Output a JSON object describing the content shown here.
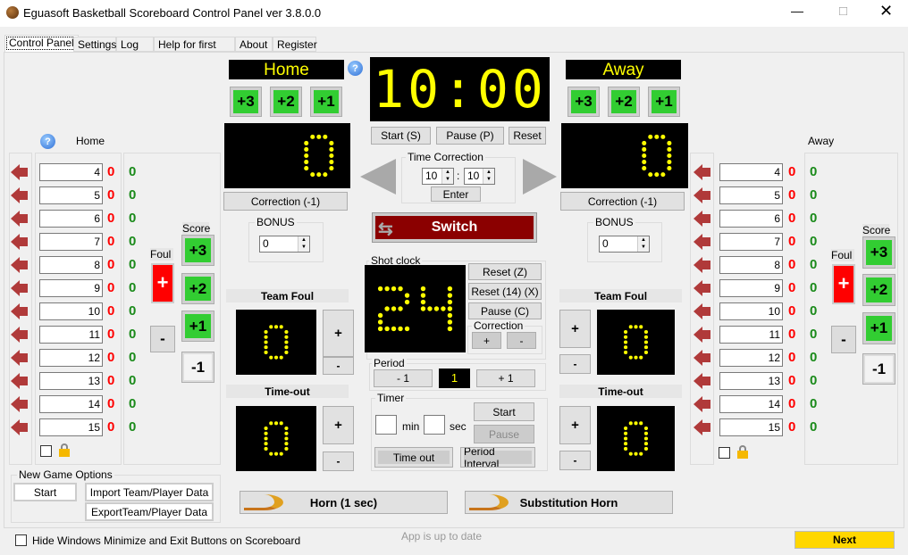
{
  "window": {
    "title": "Eguasoft Basketball Scoreboard Control Panel ver 3.8.0.0"
  },
  "tabs": [
    "Control Panel",
    "Settings",
    "Log",
    "Help for first step",
    "About",
    "Register"
  ],
  "home": {
    "name": "Home",
    "label": "Home",
    "score": "0",
    "team_foul": "0",
    "timeout": "0",
    "bonus": "0",
    "correction": "Correction (-1)",
    "players": [
      {
        "num": "4",
        "fouls": "0",
        "points": "0"
      },
      {
        "num": "5",
        "fouls": "0",
        "points": "0"
      },
      {
        "num": "6",
        "fouls": "0",
        "points": "0"
      },
      {
        "num": "7",
        "fouls": "0",
        "points": "0"
      },
      {
        "num": "8",
        "fouls": "0",
        "points": "0"
      },
      {
        "num": "9",
        "fouls": "0",
        "points": "0"
      },
      {
        "num": "10",
        "fouls": "0",
        "points": "0"
      },
      {
        "num": "11",
        "fouls": "0",
        "points": "0"
      },
      {
        "num": "12",
        "fouls": "0",
        "points": "0"
      },
      {
        "num": "13",
        "fouls": "0",
        "points": "0"
      },
      {
        "num": "14",
        "fouls": "0",
        "points": "0"
      },
      {
        "num": "15",
        "fouls": "0",
        "points": "0"
      }
    ]
  },
  "away": {
    "name": "Away",
    "label": "Away",
    "score": "0",
    "team_foul": "0",
    "timeout": "0",
    "bonus": "0",
    "correction": "Correction (-1)",
    "players": [
      {
        "num": "4",
        "fouls": "0",
        "points": "0"
      },
      {
        "num": "5",
        "fouls": "0",
        "points": "0"
      },
      {
        "num": "6",
        "fouls": "0",
        "points": "0"
      },
      {
        "num": "7",
        "fouls": "0",
        "points": "0"
      },
      {
        "num": "8",
        "fouls": "0",
        "points": "0"
      },
      {
        "num": "9",
        "fouls": "0",
        "points": "0"
      },
      {
        "num": "10",
        "fouls": "0",
        "points": "0"
      },
      {
        "num": "11",
        "fouls": "0",
        "points": "0"
      },
      {
        "num": "12",
        "fouls": "0",
        "points": "0"
      },
      {
        "num": "13",
        "fouls": "0",
        "points": "0"
      },
      {
        "num": "14",
        "fouls": "0",
        "points": "0"
      },
      {
        "num": "15",
        "fouls": "0",
        "points": "0"
      }
    ]
  },
  "labels": {
    "foul": "Foul",
    "score": "Score",
    "plus3": "+3",
    "plus2": "+2",
    "plus1": "+1",
    "minus1": "-1",
    "plus": "+",
    "minus": "-",
    "bonus": "BONUS",
    "team_foul": "Team Foul",
    "timeout": "Time-out",
    "help": "?"
  },
  "clock": {
    "value": "10:00",
    "start": "Start (S)",
    "pause": "Pause (P)",
    "reset": "Reset"
  },
  "time_correction": {
    "title": "Time Correction",
    "min": "10",
    "sec": "10",
    "sep": ":",
    "enter": "Enter"
  },
  "switch": "Switch",
  "shot_clock": {
    "title": "Shot clock",
    "value": "24",
    "reset": "Reset (Z)",
    "reset14": "Reset (14) (X)",
    "pause": "Pause (C)",
    "correction": "Correction",
    "plus": "+",
    "minus": "-"
  },
  "period": {
    "title": "Period",
    "value": "1",
    "minus": "- 1",
    "plus": "+ 1"
  },
  "timer": {
    "title": "Timer",
    "min_label": "min",
    "sec_label": "sec",
    "min": "",
    "sec": "",
    "start": "Start",
    "pause": "Pause",
    "timeout": "Time out",
    "period_interval": "Period Interval"
  },
  "horn": {
    "horn": "Horn (1 sec)",
    "substitution": "Substitution Horn"
  },
  "new_game": {
    "title": "New Game Options",
    "start": "Start",
    "import": "Import Team/Player Data",
    "export": "ExportTeam/Player Data"
  },
  "footer": {
    "hide_label": "Hide Windows Minimize and Exit Buttons on Scoreboard",
    "status": "App is up to date",
    "next": "Next"
  },
  "colors": {
    "score_green": "#32cd32",
    "foul_red": "#ff0000",
    "switch_red": "#8b0000",
    "display_yellow": "#ffff00",
    "next_yellow": "#ffd700"
  }
}
